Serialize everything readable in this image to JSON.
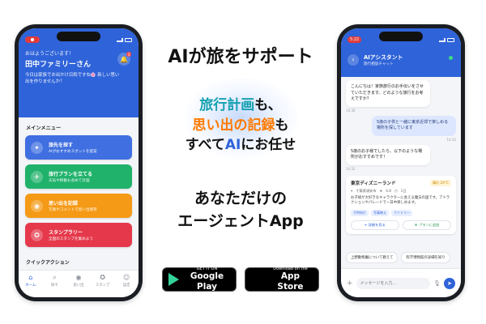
{
  "colors": {
    "brand_blue": "#2f63d9",
    "teal": "#14a0b0",
    "orange": "#ff7a00"
  },
  "headline": "AIが旅をサポート",
  "tagline": {
    "line1_highlight": "旅行計画",
    "line1_rest": "も、",
    "line2_highlight": "思い出の記録",
    "line2_rest": "も",
    "line3_pre": "すべて",
    "line3_highlight": "AI",
    "line3_post": "にお任せ"
  },
  "subheadline": {
    "line1": "あなただけの",
    "line2": "エージェントApp"
  },
  "stores": {
    "google": {
      "small": "GET IT ON",
      "big": "Google Play",
      "icon": "play-icon"
    },
    "apple": {
      "small": "Download on the",
      "big": "App Store",
      "icon": "apple-icon"
    }
  },
  "home_screen": {
    "greeting": "おはようございます！",
    "family_name": "田中ファミリーさん",
    "subtitle": "今日は家族でお出かけ日和ですね🌸 新しい思い出を作りませんか？",
    "bell_badge": "3",
    "menu_title": "メインメニュー",
    "menu": [
      {
        "title": "旅先を探す",
        "subtitle": "AIがおすすめスポットを提案",
        "icon": "compass-icon",
        "color": "#3f6fe0"
      },
      {
        "title": "旅行プランを立てる",
        "subtitle": "天気や移動も含めて計画",
        "icon": "plane-icon",
        "color": "#20b26b"
      },
      {
        "title": "思い出を記録",
        "subtitle": "写真やコメントで思い出保存",
        "icon": "camera-icon",
        "color": "#f59a16"
      },
      {
        "title": "スタンプラリー",
        "subtitle": "全国のスタンプを集めよう",
        "icon": "badge-icon",
        "color": "#e5394b"
      }
    ],
    "quick_title": "クイックアクション",
    "tabs": [
      {
        "label": "ホーム",
        "icon": "home-icon",
        "active": true
      },
      {
        "label": "探す",
        "icon": "search-icon",
        "active": false
      },
      {
        "label": "思い出",
        "icon": "camera-icon",
        "active": false
      },
      {
        "label": "スタンプ",
        "icon": "medal-icon",
        "active": false
      },
      {
        "label": "設定",
        "icon": "person-icon",
        "active": false
      }
    ]
  },
  "chat_screen": {
    "status_time": "5:22",
    "title": "AIアシスタント",
    "subtitle": "旅行相談チャット",
    "messages": [
      {
        "from": "ai",
        "text": "こんにちは！家族旅行のお手伝いをさせていただきます。どのような旅行をお考えですか？",
        "time": "14:30"
      },
      {
        "from": "user",
        "text": "5歳の子供と一緒に東京近郊で楽しめる場所を探しています",
        "time": "14:32"
      },
      {
        "from": "ai",
        "text": "5歳のお子様でしたら、以下のような場所がおすすめです！",
        "time": "14:32"
      }
    ],
    "place": {
      "name": "東京ディズニーランド",
      "weather": "晴れ 24°C",
      "location": "千葉県浦安市",
      "rating": "4.8",
      "duration": "1日",
      "description": "お子様が大好きなキャラクターに会える魔法の国です。アトラクションやパレードで一日中楽しめます。",
      "tags": [
        "子供向け",
        "写真映え",
        "ファミリー"
      ],
      "actions": [
        "詳細を見る",
        "プランに追加"
      ]
    },
    "suggestions": [
      "上野動物園について教えて",
      "科学博物館の詳細を知り"
    ],
    "input_placeholder": "メッセージを入力..."
  }
}
